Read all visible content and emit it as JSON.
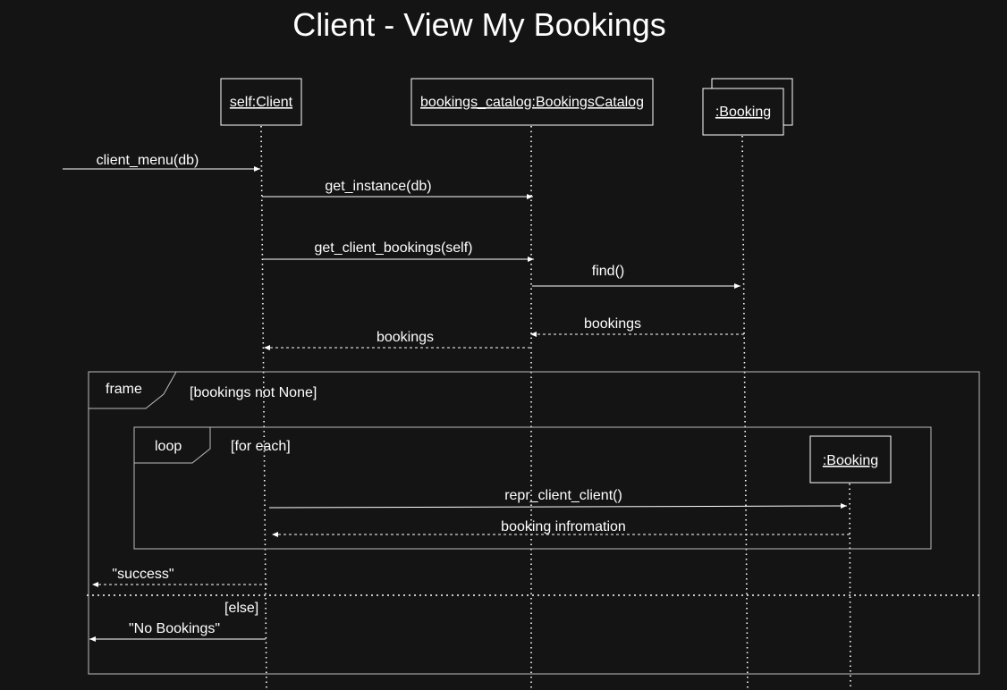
{
  "title": "Client - View My Bookings",
  "participants": [
    {
      "id": "client",
      "label": "self:Client"
    },
    {
      "id": "catalog",
      "label": "bookings_catalog:BookingsCatalog"
    },
    {
      "id": "booking",
      "label": ":Booking"
    },
    {
      "id": "booking2",
      "label": ":Booking"
    }
  ],
  "messages": [
    {
      "id": "m1",
      "label": "client_menu(db)",
      "kind": "call"
    },
    {
      "id": "m2",
      "label": "get_instance(db)",
      "kind": "call"
    },
    {
      "id": "m3",
      "label": "get_client_bookings(self)",
      "kind": "call"
    },
    {
      "id": "m4",
      "label": "find()",
      "kind": "call"
    },
    {
      "id": "m5",
      "label": "bookings",
      "kind": "return"
    },
    {
      "id": "m6",
      "label": "bookings",
      "kind": "return"
    },
    {
      "id": "m7",
      "label": "repr_client_client()",
      "kind": "call"
    },
    {
      "id": "m8",
      "label": "booking infromation",
      "kind": "return"
    },
    {
      "id": "m9",
      "label": "\"success\"",
      "kind": "return"
    },
    {
      "id": "m10",
      "label": "\"No Bookings\"",
      "kind": "call"
    }
  ],
  "fragments": {
    "outer": {
      "keyword": "frame",
      "guard": "[bookings not None]",
      "else_guard": "[else]"
    },
    "loop": {
      "keyword": "loop",
      "guard": "[for each]"
    }
  }
}
